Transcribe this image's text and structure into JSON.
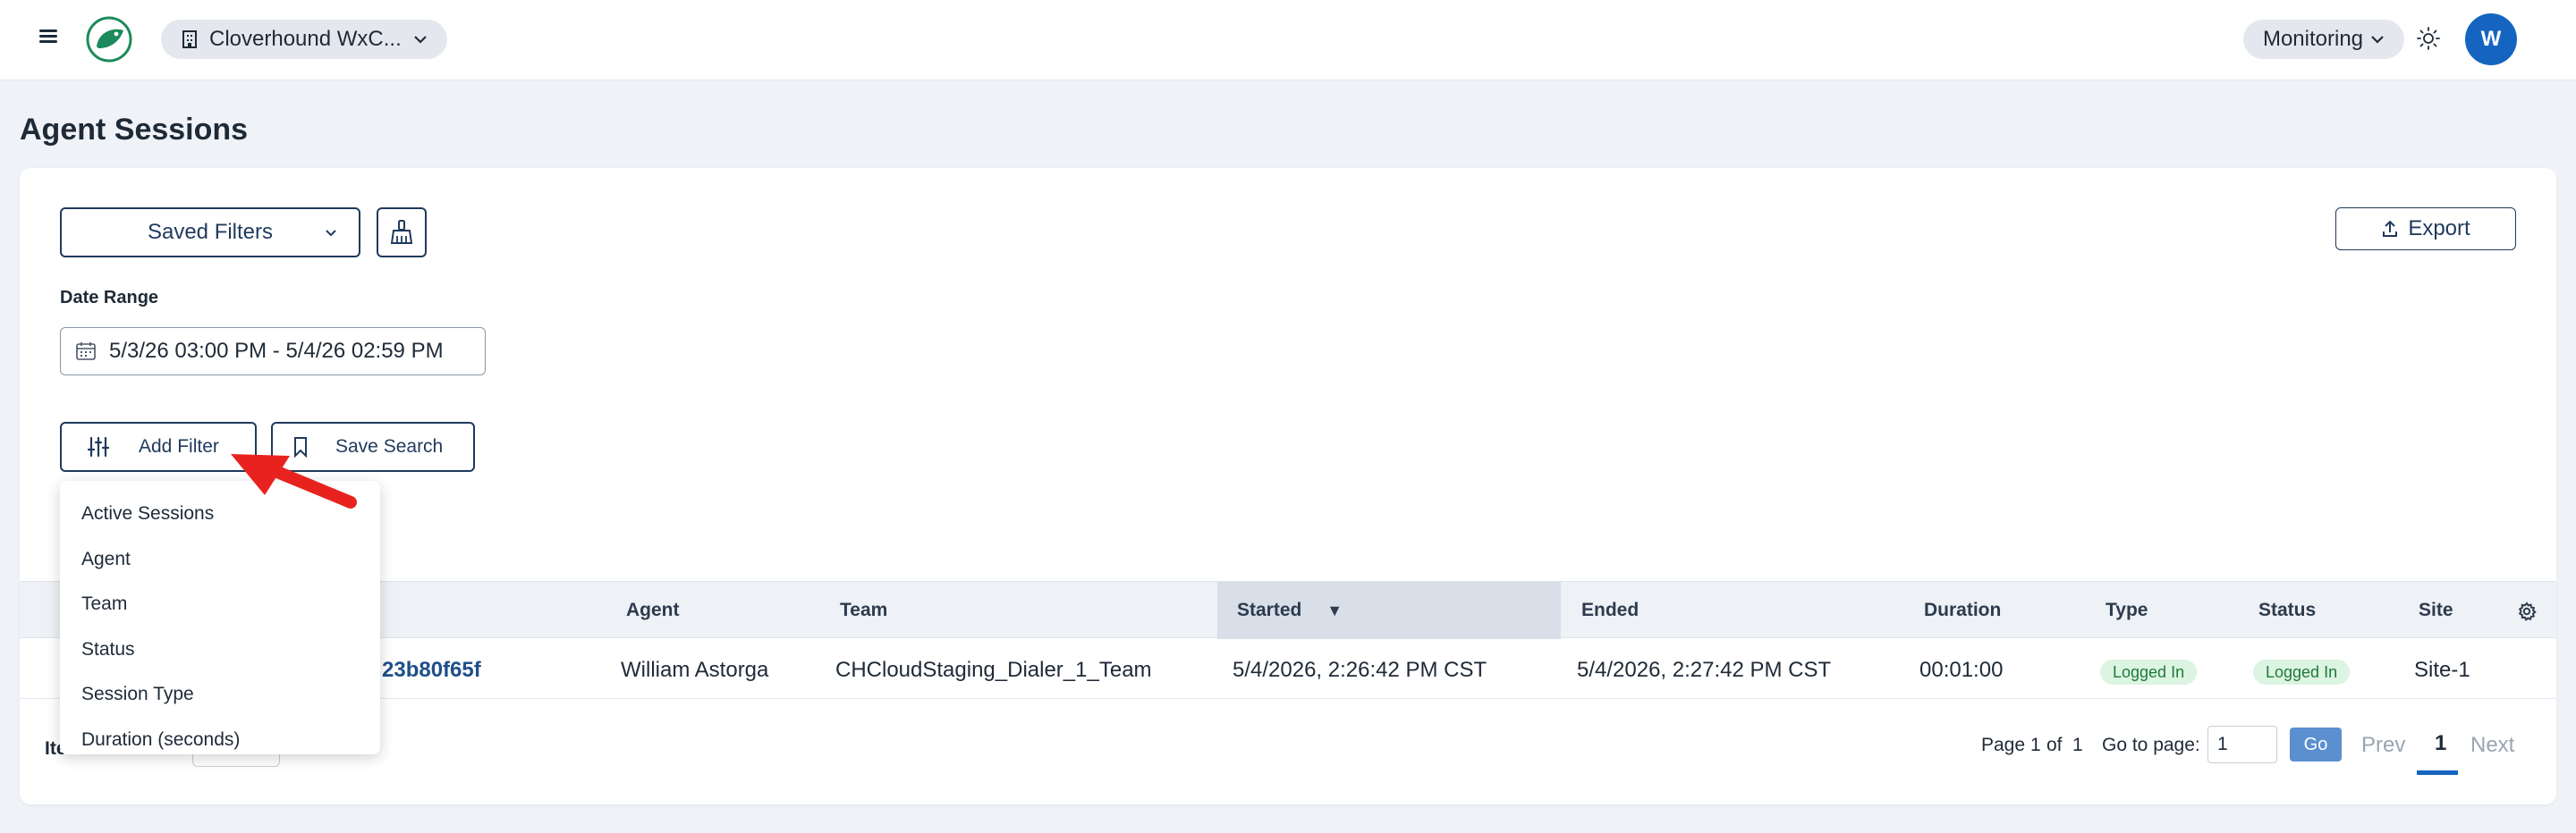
{
  "header": {
    "org_name": "Cloverhound WxC...",
    "monitoring_label": "Monitoring",
    "avatar_initial": "W"
  },
  "page": {
    "title": "Agent Sessions"
  },
  "toolbar": {
    "saved_filters_label": "Saved Filters",
    "export_label": "Export",
    "date_range_label": "Date Range",
    "date_range_value": "5/3/26 03:00 PM - 5/4/26 02:59 PM",
    "add_filter_label": "Add Filter",
    "save_search_label": "Save Search"
  },
  "filter_menu": {
    "items": [
      "Active Sessions",
      "Agent",
      "Team",
      "Status",
      "Session Type",
      "Duration (seconds)"
    ]
  },
  "table": {
    "columns": [
      "Agent",
      "Team",
      "Started",
      "Ended",
      "Duration",
      "Type",
      "Status",
      "Site"
    ],
    "sort_column": "Started",
    "sort_direction": "▼",
    "rows": [
      {
        "session_id": "23b80f65f",
        "agent": "William Astorga",
        "team": "CHCloudStaging_Dialer_1_Team",
        "started": "5/4/2026, 2:26:42 PM CST",
        "ended": "5/4/2026, 2:27:42 PM CST",
        "duration": "00:01:00",
        "type": "Logged In",
        "status": "Logged In",
        "site": "Site-1"
      }
    ]
  },
  "footer": {
    "items_per_page_label": "Ite",
    "items_per_page_value": "",
    "page_label": "Page",
    "page_current": "1",
    "of_label": "of",
    "page_total": "1",
    "go_to_label": "Go to page:",
    "go_to_value": "1",
    "go_label": "Go",
    "prev_label": "Prev",
    "current_page_link": "1",
    "next_label": "Next"
  },
  "colors": {
    "accent": "#1565c0",
    "badge_bg": "#dcf4e2",
    "badge_text": "#1f7a3a",
    "annotation_arrow": "#e8231f"
  }
}
